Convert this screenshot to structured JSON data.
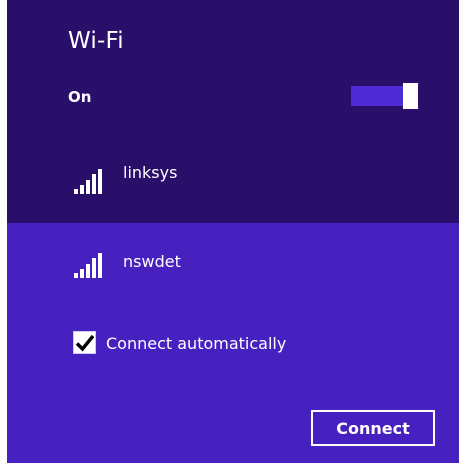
{
  "panel": {
    "title": "Wi-Fi",
    "state_label": "On",
    "toggle_on": true
  },
  "networks": [
    {
      "name": "linksys",
      "icon": "wifi-signal-icon",
      "signal_bars": 5
    },
    {
      "name": "nswdet",
      "icon": "wifi-signal-icon",
      "signal_bars": 5,
      "selected": true
    }
  ],
  "selected_network": {
    "connect_automatically_label": "Connect automatically",
    "connect_automatically_checked": true,
    "connect_button_label": "Connect"
  },
  "colors": {
    "header_background": "#2a0f6a",
    "selected_background": "#4721bf",
    "toggle_track": "#4c2bd6",
    "text": "#ffffff"
  }
}
